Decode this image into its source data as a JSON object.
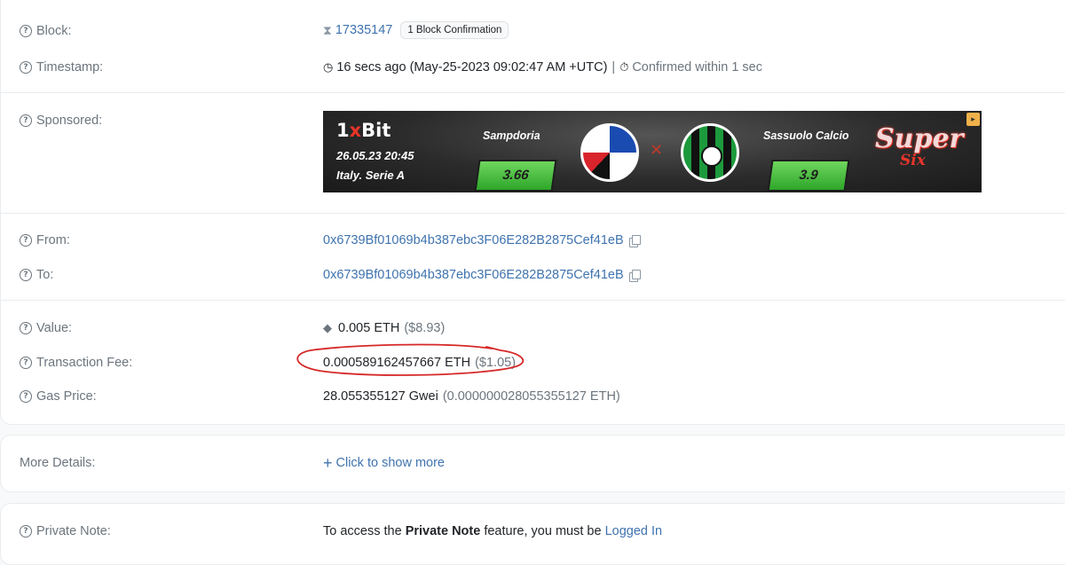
{
  "transaction": {
    "block": {
      "label": "Block:",
      "number": "17335147",
      "confirmations": "1 Block Confirmation"
    },
    "timestamp": {
      "label": "Timestamp:",
      "value": "16 secs ago (May-25-2023 09:02:47 AM +UTC)",
      "separator": "|",
      "confirmed": "Confirmed within 1 sec"
    },
    "sponsored": {
      "label": "Sponsored:",
      "ad": {
        "brand_prefix": "1",
        "brand_x": "x",
        "brand_suffix": "Bit",
        "date": "26.05.23 20:45",
        "league": "Italy. Serie A",
        "team_home": "Sampdoria",
        "team_away": "Sassuolo Calcio",
        "odds_home": "3.66",
        "odds_away": "3.9",
        "promo_title": "Super",
        "promo_subtitle": "Six"
      }
    },
    "from": {
      "label": "From:",
      "address": "0x6739Bf01069b4b387ebc3F06E282B2875Cef41eB"
    },
    "to": {
      "label": "To:",
      "address": "0x6739Bf01069b4b387ebc3F06E282B2875Cef41eB"
    },
    "value": {
      "label": "Value:",
      "amount": "0.005 ETH",
      "usd": "($8.93)"
    },
    "fee": {
      "label": "Transaction Fee:",
      "amount": "0.000589162457667 ETH",
      "usd": "($1.05)"
    },
    "gas_price": {
      "label": "Gas Price:",
      "gwei": "28.055355127 Gwei",
      "eth": "(0.000000028055355127 ETH)"
    }
  },
  "more_details": {
    "label": "More Details:",
    "link": "Click to show more"
  },
  "private_note": {
    "label": "Private Note:",
    "text_before": "To access the ",
    "feature": "Private Note",
    "text_after": " feature, you must be ",
    "link": "Logged In"
  },
  "icons": {
    "question": "question-circle-icon",
    "hourglass": "hourglass-icon",
    "clock": "clock-icon",
    "timer": "stopwatch-icon",
    "copy": "copy-icon",
    "eth": "ethereum-icon",
    "plus": "plus-icon"
  },
  "colors": {
    "link": "#3f73af",
    "muted": "#6c757d",
    "annotation": "#d62828"
  }
}
